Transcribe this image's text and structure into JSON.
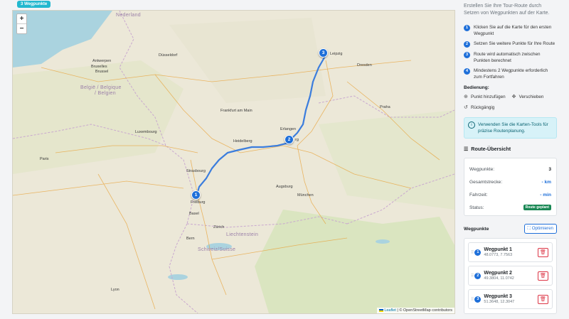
{
  "top_badge": "3 Wegpunkte",
  "map": {
    "zoom_in": "+",
    "zoom_out": "−",
    "attribution_leaflet": "Leaflet",
    "attribution_rest": "| © OpenStreetMap contributors",
    "countries": [
      {
        "id": "nederland",
        "text": "Nederland"
      },
      {
        "id": "belgie",
        "text": "België / Belgique"
      },
      {
        "id": "belgien",
        "text": "/ Belgien"
      },
      {
        "id": "liechtenstein",
        "text": "Liechtenstein"
      },
      {
        "id": "schweiz",
        "text": "Schweiz/Suisse"
      }
    ],
    "cities": [
      {
        "id": "dusseldorf",
        "text": "Düsseldorf"
      },
      {
        "id": "antwerpen",
        "text": "Antwerpen"
      },
      {
        "id": "bruxelles",
        "text": "Bruxelles"
      },
      {
        "id": "brussel",
        "text": "Brussel"
      },
      {
        "id": "frankfurt",
        "text": "Frankfurt am Main"
      },
      {
        "id": "luxembourg",
        "text": "Luxembourg"
      },
      {
        "id": "paris",
        "text": "Paris"
      },
      {
        "id": "heidelberg",
        "text": "Heidelberg"
      },
      {
        "id": "strasbourg",
        "text": "Strasbourg"
      },
      {
        "id": "dresden",
        "text": "Dresden"
      },
      {
        "id": "leipzig",
        "text": "Leipzig"
      },
      {
        "id": "prague",
        "text": "Praha"
      },
      {
        "id": "erlangen",
        "text": "Erlangen"
      },
      {
        "id": "munchen",
        "text": "München"
      },
      {
        "id": "augsburg",
        "text": "Augsburg"
      },
      {
        "id": "zurich",
        "text": "Zürich"
      },
      {
        "id": "bern",
        "text": "Bern"
      },
      {
        "id": "basel",
        "text": "Basel"
      },
      {
        "id": "lyon",
        "text": "Lyon"
      },
      {
        "id": "freiburg",
        "text": "Freiburg"
      },
      {
        "id": "nurnberg",
        "text": "rg"
      }
    ],
    "markers": [
      {
        "num": "1"
      },
      {
        "num": "2"
      },
      {
        "num": "3"
      }
    ]
  },
  "panel": {
    "intro": "Erstellen Sie Ihre Tour-Route durch Setzen von Wegpunkten auf der Karte.",
    "steps": [
      {
        "num": "1",
        "text": "Klicken Sie auf die Karte für den ersten Wegpunkt"
      },
      {
        "num": "2",
        "text": "Setzen Sie weitere Punkte für Ihre Route"
      },
      {
        "num": "3",
        "text": "Route wird automatisch zwischen Punkten berechnet"
      },
      {
        "num": "4",
        "text": "Mindestens 2 Wegpunkte erforderlich zum Fortfahren"
      }
    ],
    "controls_title": "Bedienung:",
    "controls": {
      "add": "Punkt hinzufügen",
      "move": "Verschieben",
      "undo": "Rückgängig"
    },
    "info": "Verwenden Sie die Karten-Tools für präzise Routenplanung.",
    "summary": {
      "title": "Route-Übersicht",
      "waypoints_label": "Wegpunkte:",
      "waypoints_value": "3",
      "distance_label": "Gesamtstrecke:",
      "distance_value": "- km",
      "time_label": "Fahrzeit:",
      "time_value": "- min",
      "status_label": "Status:",
      "status_value": "Route geplant"
    },
    "waypoints_title": "Wegpunkte",
    "optimize_label": "Optimieren",
    "waypoints": [
      {
        "num": "1",
        "name": "Wegpunkt 1",
        "coords": "48.0773, 7.7563"
      },
      {
        "num": "2",
        "name": "Wegpunkt 2",
        "coords": "49.3804, 11.0742"
      },
      {
        "num": "3",
        "name": "Wegpunkt 3",
        "coords": "51.3648, 12.3047"
      }
    ]
  },
  "colors": {
    "accent": "#1e6fd9",
    "route": "#3b7ddd",
    "status_green": "#198754",
    "info_bg": "#d7f2f8",
    "danger": "#dc3545"
  }
}
